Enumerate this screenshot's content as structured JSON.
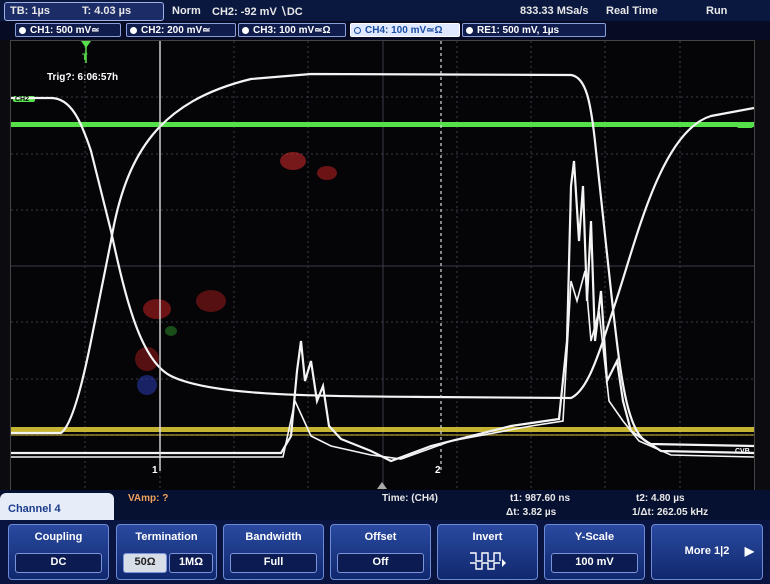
{
  "status": {
    "timebase": "TB: 1µs",
    "trigger_time": "T: 4.03 µs",
    "trigger_mode": "Norm",
    "trigger_info": "CH2: -92 mV ∖DC",
    "sample_rate": "833.33 MSa/s",
    "acq_mode": "Real Time",
    "run_state": "Run"
  },
  "channels": [
    {
      "label": "CH1: 500 mV≃"
    },
    {
      "label": "CH2: 200 mV≃"
    },
    {
      "label": "CH3: 100 mV≃Ω"
    },
    {
      "label": "CH4: 100 mV≃Ω"
    },
    {
      "label": "RE1: 500 mV, 1µs"
    }
  ],
  "screen": {
    "trigger_text": "Trig?: 6:06:57h",
    "trigger_marker": "T",
    "cursor1_label": "1",
    "cursor2_label": "2",
    "ch_marker_left": "CH2",
    "ch_marker_right": "CVB",
    "colors": {
      "ch2": "#56e04a",
      "ch1": "#e8d23a",
      "trace": "#f4f4f4",
      "grid": "#3c3c48"
    }
  },
  "readout": {
    "tab": "Channel 4",
    "vamp": "VAmp: ?",
    "time_source": "Time: (CH4)",
    "t1": "t1: 987.60 ns",
    "t2": "t2: 4.80 µs",
    "dt": "Δt: 3.82 µs",
    "inv_dt": "1/Δt: 262.05 kHz"
  },
  "softkeys": {
    "coupling": {
      "title": "Coupling",
      "value": "DC"
    },
    "termination": {
      "title": "Termination",
      "opt1": "50Ω",
      "opt2": "1MΩ"
    },
    "bandwidth": {
      "title": "Bandwidth",
      "value": "Full"
    },
    "offset": {
      "title": "Offset",
      "value": "Off"
    },
    "invert": {
      "title": "Invert"
    },
    "yscale": {
      "title": "Y-Scale",
      "value": "100 mV"
    },
    "more": {
      "title": "More 1|2"
    }
  }
}
